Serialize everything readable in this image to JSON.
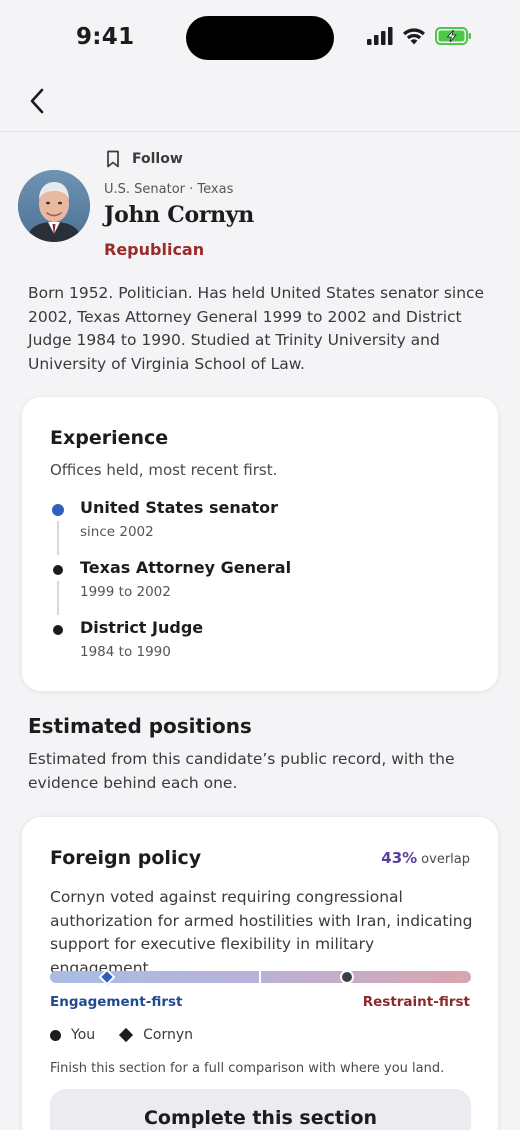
{
  "status_bar": {
    "time": "9:41"
  },
  "profile": {
    "follow_label": "Follow",
    "subtitle": "U.S. Senator · Texas",
    "name": "John Cornyn",
    "party": "Republican",
    "bio": "Born 1952. Politician. Has held United States senator since 2002, Texas Attorney General 1999 to 2002 and District Judge 1984 to 1990. Studied at Trinity University and University of Virginia School of Law."
  },
  "experience": {
    "title": "Experience",
    "subtitle": "Offices held, most recent first.",
    "items": [
      {
        "title": "United States senator",
        "dates": "since 2002",
        "current": true
      },
      {
        "title": "Texas Attorney General",
        "dates": "1999 to 2002",
        "current": false
      },
      {
        "title": "District Judge",
        "dates": "1984 to 1990",
        "current": false
      }
    ]
  },
  "positions": {
    "title": "Estimated positions",
    "description": "Estimated from this candidate’s public record, with the evidence behind each one.",
    "foreign_policy": {
      "title": "Foreign policy",
      "overlap_pct": "43%",
      "overlap_label": "overlap",
      "text": "Cornyn voted against requiring congressional authorization for armed hostilities with Iran, indicating support for executive flexibility in military engagement.",
      "scale_left": "Engagement-first",
      "scale_right": "Restraint-first",
      "candidate_position": 0.14,
      "you_position": 0.71,
      "legend_you": "You",
      "legend_candidate": "Cornyn",
      "note": "Finish this section for a full comparison with where you land.",
      "cta": "Complete this section"
    }
  },
  "colors": {
    "party": "#9b2a2a",
    "accent": "#2f5fb8",
    "overlap": "#5b3f9e"
  }
}
